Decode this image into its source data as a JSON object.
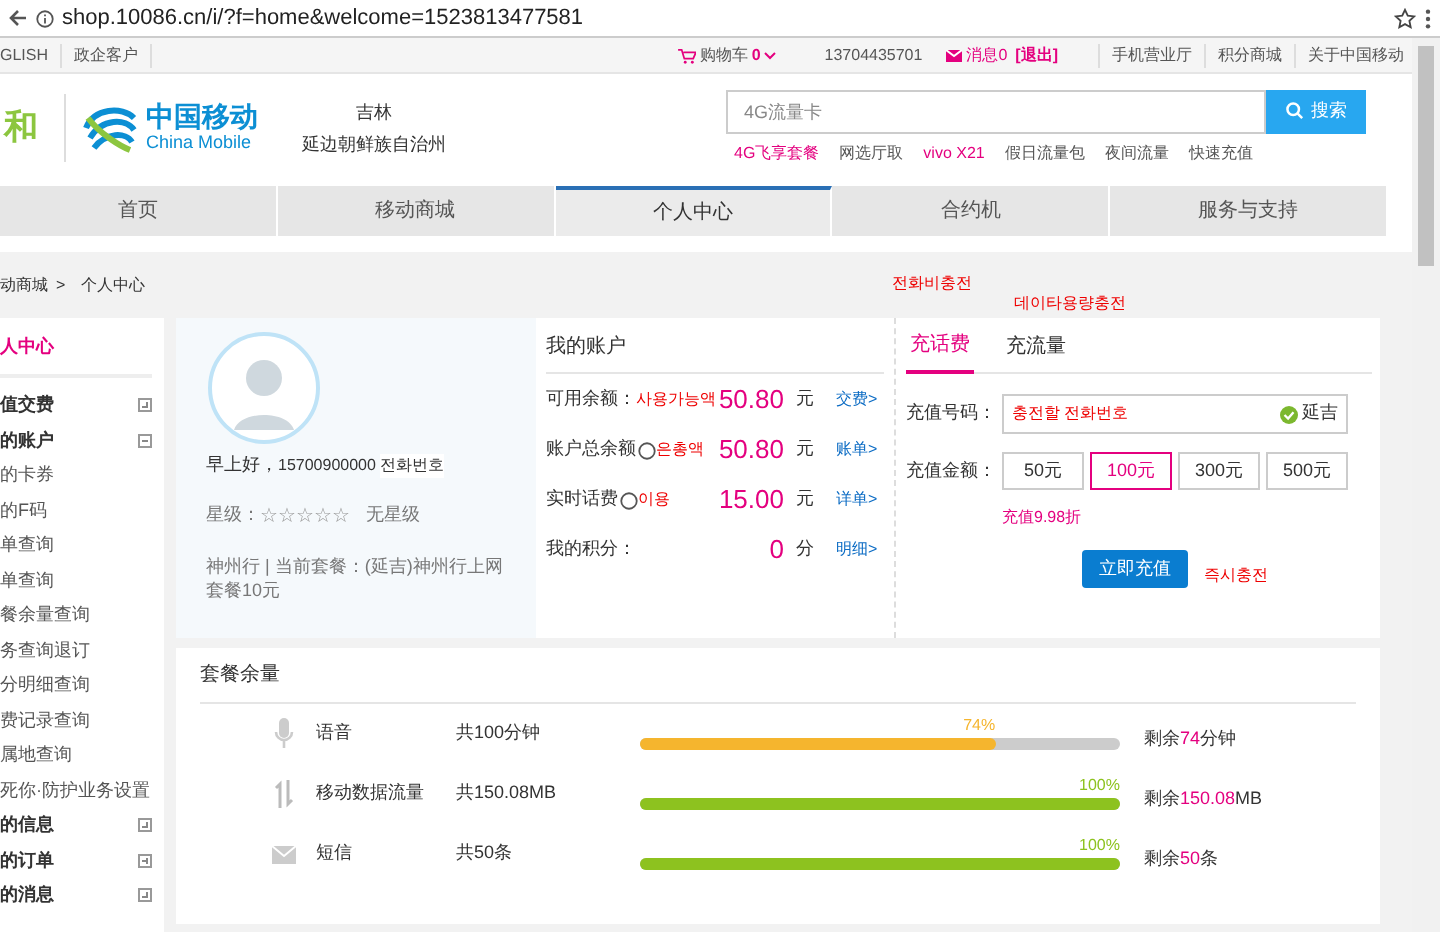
{
  "browser": {
    "url": "shop.10086.cn/i/?f=home&welcome=1523813477581"
  },
  "top_bar": {
    "left": [
      "GLISH",
      "政企客户"
    ],
    "cart": {
      "label": "购物车",
      "count": "0"
    },
    "phone": "13704435701",
    "messages": "消息0",
    "logout": "[退出]",
    "right": [
      "手机营业厅",
      "积分商城",
      "关于中国移动"
    ]
  },
  "header": {
    "brand_mark": "和",
    "logo_cn": "中国移动",
    "logo_en": "China Mobile",
    "province": "吉林",
    "city": "延边朝鲜族自治州",
    "search": {
      "placeholder": "4G流量卡",
      "button": "搜索"
    },
    "hot_links": [
      {
        "label": "4G飞享套餐",
        "highlight": true
      },
      {
        "label": "网选厅取",
        "highlight": false
      },
      {
        "label": "vivo X21",
        "highlight": true
      },
      {
        "label": "假日流量包",
        "highlight": false
      },
      {
        "label": "夜间流量",
        "highlight": false
      },
      {
        "label": "快速充值",
        "highlight": false
      }
    ]
  },
  "nav": [
    {
      "label": "首页",
      "selected": false
    },
    {
      "label": "移动商城",
      "selected": false
    },
    {
      "label": "个人中心",
      "selected": true
    },
    {
      "label": "合约机",
      "selected": false
    },
    {
      "label": "服务与支持",
      "selected": false
    }
  ],
  "breadcrumb": [
    "动商城",
    ">",
    "个人中心"
  ],
  "sidebar": [
    {
      "kind": "title",
      "label": "人中心"
    },
    {
      "kind": "group",
      "label": "值交费",
      "expanded": false
    },
    {
      "kind": "group",
      "label": "的账户",
      "expanded": true
    },
    {
      "kind": "link",
      "label": "的卡券"
    },
    {
      "kind": "link",
      "label": "的F码"
    },
    {
      "kind": "link",
      "label": "单查询"
    },
    {
      "kind": "link",
      "label": "单查询"
    },
    {
      "kind": "link",
      "label": "餐余量查询"
    },
    {
      "kind": "link",
      "label": "务查询退订"
    },
    {
      "kind": "link",
      "label": "分明细查询"
    },
    {
      "kind": "link",
      "label": "费记录查询"
    },
    {
      "kind": "link",
      "label": "属地查询"
    },
    {
      "kind": "link",
      "label": "死你·防护业务设置"
    },
    {
      "kind": "group",
      "label": "的信息",
      "expanded": false
    },
    {
      "kind": "group",
      "label": "的订单",
      "expanded": false
    },
    {
      "kind": "group",
      "label": "的消息",
      "expanded": false
    }
  ],
  "profile": {
    "greeting": "早上好，",
    "number": "15700900000",
    "annotation": "전화번호",
    "star_label": "星级：",
    "stars": 0,
    "star_text": "无星级",
    "plan_line1": "神州行 | 当前套餐：(延吉)神州行上网",
    "plan_line2": "套餐10元"
  },
  "account": {
    "title": "我的账户",
    "rows": [
      {
        "label": "可用余额：",
        "circled": false,
        "annotation": "사용가능액",
        "amount": "50.80",
        "unit": "元",
        "link": "交费>"
      },
      {
        "label": "账户总余额",
        "circled": true,
        "annotation": "은총액",
        "amount": "50.80",
        "unit": "元",
        "link": "账单>"
      },
      {
        "label": "实时话费",
        "circled": true,
        "annotation": "이용",
        "amount": "15.00",
        "unit": "元",
        "link": "详单>"
      },
      {
        "label": "我的积分：",
        "circled": false,
        "annotation": "",
        "amount": "0",
        "unit": "分",
        "link": "明细>"
      }
    ]
  },
  "recharge": {
    "tabs": [
      {
        "label": "充话费",
        "selected": true
      },
      {
        "label": "充流量",
        "selected": false
      }
    ],
    "tab_annotations": [
      "전화비충전",
      "데이타용량충전"
    ],
    "number_label": "充值号码：",
    "number_value": "충전할 전화번호",
    "region": "延吉",
    "amount_label": "充值金额：",
    "amounts": [
      {
        "label": "50元",
        "selected": false
      },
      {
        "label": "100元",
        "selected": true
      },
      {
        "label": "300元",
        "selected": false
      },
      {
        "label": "500元",
        "selected": false
      }
    ],
    "discount": "充值9.98折",
    "button": "立即充值",
    "button_annotation": "즉시충전"
  },
  "package": {
    "title": "套餐余量",
    "rows": [
      {
        "kind": "voice",
        "name": "语音",
        "total": "共100分钟",
        "level": 0.74,
        "percent": "74%",
        "color": "#f5b52e",
        "remain_prefix": "剩余",
        "remain_value": "74",
        "remain_unit": "分钟"
      },
      {
        "kind": "data",
        "name": "移动数据流量",
        "total": "共150.08MB",
        "level": 1,
        "percent": "100%",
        "color": "#8dc21f",
        "remain_prefix": "剩余",
        "remain_value": "150.08",
        "remain_unit": "MB"
      },
      {
        "kind": "sms",
        "name": "短信",
        "total": "共50条",
        "level": 1,
        "percent": "100%",
        "color": "#8dc21f",
        "remain_prefix": "剩余",
        "remain_value": "50",
        "remain_unit": "条"
      }
    ]
  }
}
